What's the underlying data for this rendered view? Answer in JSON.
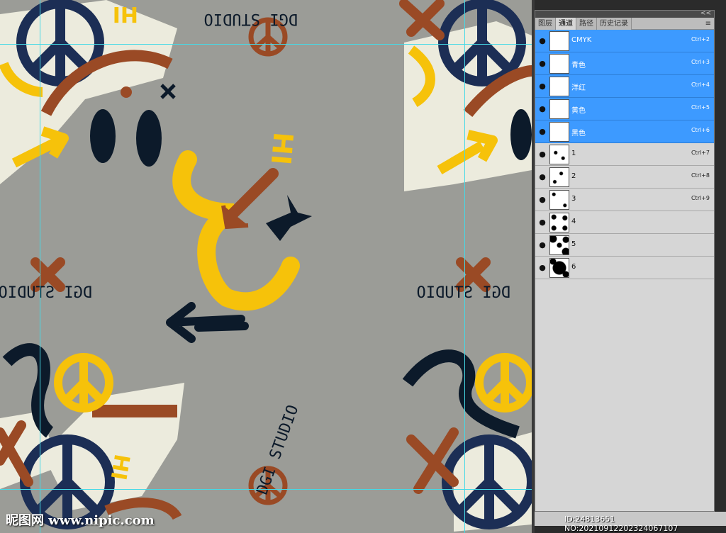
{
  "canvas": {
    "artwork_text": "DGI STUDIO",
    "hi_text": "HI",
    "watermark": "昵图网 www.nipic.com",
    "colors": {
      "background": "#9b9c97",
      "navy": "#1c2e55",
      "dark_navy": "#0c1a2a",
      "yellow": "#f6c20a",
      "rust": "#9a4a25",
      "cream": "#ecebdd",
      "guide": "#46d9e6"
    }
  },
  "panel": {
    "collapse_icon": "<<",
    "tabs": [
      {
        "label": "图层"
      },
      {
        "label": "通道"
      },
      {
        "label": "路径"
      },
      {
        "label": "历史记录"
      }
    ],
    "active_tab": "通道",
    "menu_icon": "≡",
    "channels": [
      {
        "name": "CMYK",
        "shortcut": "Ctrl+2",
        "selected": true
      },
      {
        "name": "青色",
        "shortcut": "Ctrl+3",
        "selected": true
      },
      {
        "name": "洋红",
        "shortcut": "Ctrl+4",
        "selected": true
      },
      {
        "name": "黄色",
        "shortcut": "Ctrl+5",
        "selected": true
      },
      {
        "name": "黑色",
        "shortcut": "Ctrl+6",
        "selected": true
      },
      {
        "name": "1",
        "shortcut": "Ctrl+7",
        "selected": false
      },
      {
        "name": "2",
        "shortcut": "Ctrl+8",
        "selected": false
      },
      {
        "name": "3",
        "shortcut": "Ctrl+9",
        "selected": false
      },
      {
        "name": "4",
        "shortcut": "",
        "selected": false
      },
      {
        "name": "5",
        "shortcut": "",
        "selected": false
      },
      {
        "name": "6",
        "shortcut": "",
        "selected": false
      }
    ]
  },
  "footer": {
    "id_text": "ID:24813651 NO:20210912202324067107"
  }
}
